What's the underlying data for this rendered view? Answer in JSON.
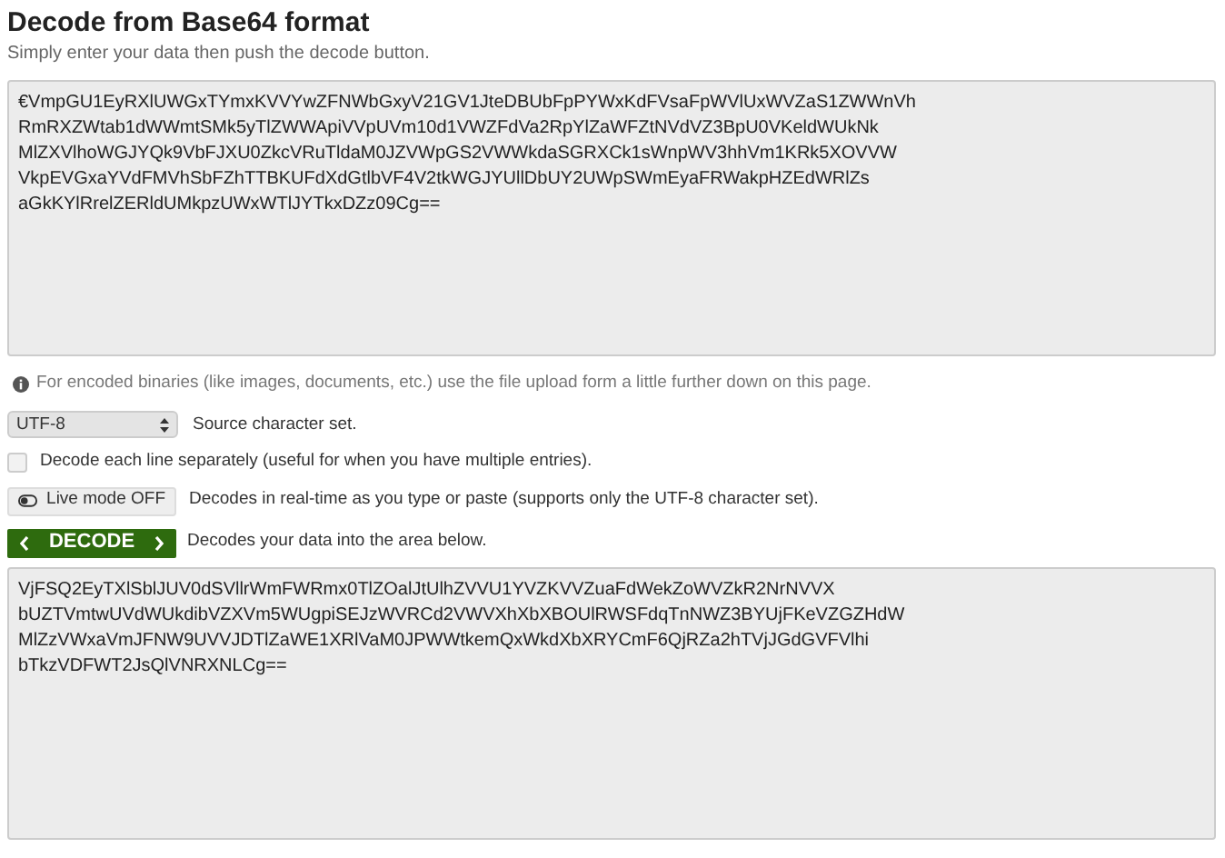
{
  "title": "Decode from Base64 format",
  "subtitle": "Simply enter your data then push the decode button.",
  "input": {
    "value": "€VmpGU1EyRXlUWGxTYmxKVVYwZFNWbGxyV21GV1JteDBUbFpPYWxKdFVsaFpWVlUxWVZaS1ZWWnVh\nRmRXZWtab1dWWmtSMk5yTlZWWApiVVpUVm10d1VWZFdVa2RpYlZaWFZtNVdVZ3BpU0VKeldWUkNk\nMlZXVlhoWGJYQk9VbFJXU0ZkcVRuTldaM0JZVWpGS2VWWkdaSGRXCk1sWnpWV3hhVm1KRk5XOVVW\nVkpEVGxaYVdFMVhSbFZhTTBKUFdXdGtlbVF4V2tkWGJYUllDbUY2UWpSWmEyaFRWakpHZEdWRlZs\naGkKYlRrelZERldUMkpzUWxWTlJYTkxDZz09Cg=="
  },
  "info": "For encoded binaries (like images, documents, etc.) use the file upload form a little further down on this page.",
  "charset": {
    "value": "UTF-8",
    "label": "Source character set."
  },
  "separate": {
    "checked": false,
    "label": "Decode each line separately (useful for when you have multiple entries)."
  },
  "live": {
    "on": false,
    "button": "Live mode OFF",
    "label": "Decodes in real-time as you type or paste (supports only the UTF-8 character set)."
  },
  "decode": {
    "button": "DECODE",
    "label": "Decodes your data into the area below."
  },
  "output": {
    "value": "VjFSQ2EyTXlSblJUV0dSVllrWmFWRmx0TlZOalJtUlhZVVU1YVZKVVZuaFdWekZoWVZkR2NrNVVX\nbUZTVmtwUVdWUkdibVZXVm5WUgpiSEJzWVRCd2VWVXhXbXBOUlRWSFdqTnNWZ3BYUjFKeVZGZHdW\nMlZzVWxaVmJFNW9UVVJDTlZaWE1XRlVaM0JPWWtkemQxWkdXbXRYCmF6QjRZa2hTVjJGdGVFVlhi\nbTkzVDFWT2JsQlVNRXNLCg=="
  }
}
